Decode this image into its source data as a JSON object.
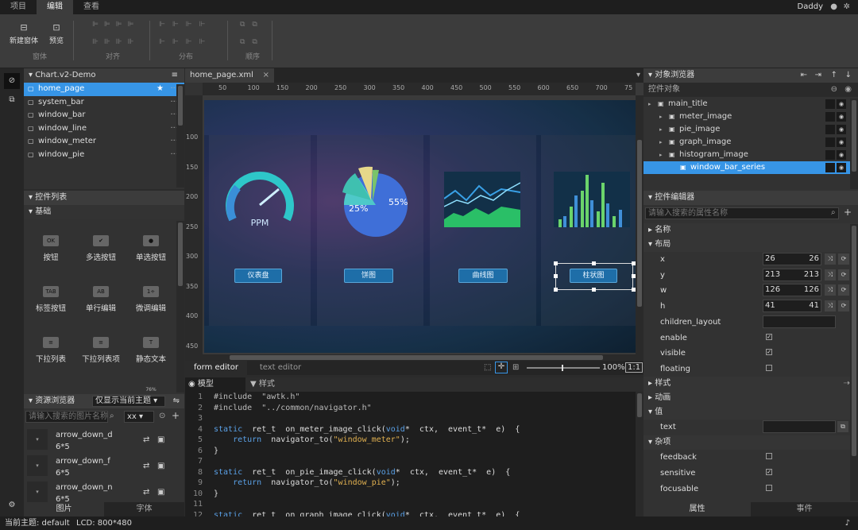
{
  "menu": {
    "tabs": [
      "项目",
      "编辑",
      "查看"
    ],
    "active": 1,
    "user": "Daddy"
  },
  "ribbon": {
    "window_group": {
      "label": "窗体",
      "new_window": "新建窗体",
      "preview": "预览"
    },
    "align_label": "对齐",
    "distribute_label": "分布",
    "order_label": "顺序"
  },
  "project": {
    "title": "Chart.v2-Demo",
    "items": [
      "home_page",
      "system_bar",
      "window_bar",
      "window_line",
      "window_meter",
      "window_pie"
    ],
    "selected": 0
  },
  "widgets": {
    "title": "控件列表",
    "category": "基础",
    "items": [
      {
        "label": "按钮",
        "glyph": "OK"
      },
      {
        "label": "多选按钮",
        "glyph": "✔"
      },
      {
        "label": "单选按钮",
        "glyph": "●"
      },
      {
        "label": "标签按钮",
        "glyph": "TAB"
      },
      {
        "label": "单行编辑",
        "glyph": "AB"
      },
      {
        "label": "微调编辑",
        "glyph": "1÷"
      },
      {
        "label": "下拉列表",
        "glyph": "≡"
      },
      {
        "label": "下拉列表项",
        "glyph": "≡"
      },
      {
        "label": "静态文本",
        "glyph": "T"
      }
    ],
    "partial_glyph": "76%"
  },
  "resources": {
    "title": "资源浏览器",
    "filter": "仅显示当前主题",
    "search_placeholder": "请输入搜索的图片名称",
    "ext": "xx",
    "items": [
      {
        "name": "arrow_down_d",
        "size": "6*5"
      },
      {
        "name": "arrow_down_f",
        "size": "6*5"
      },
      {
        "name": "arrow_down_n",
        "size": "6*5"
      }
    ],
    "tabs": [
      "图片",
      "字体"
    ]
  },
  "editor": {
    "tab": "home_page.xml",
    "ruler_h": [
      "50",
      "100",
      "150",
      "200",
      "250",
      "300",
      "350",
      "400",
      "450",
      "500",
      "550",
      "600",
      "650",
      "700",
      "75"
    ],
    "ruler_v": [
      "100",
      "150",
      "200",
      "250",
      "300",
      "350",
      "400",
      "450"
    ],
    "buttons": [
      "仪表盘",
      "饼图",
      "曲线图",
      "柱状图"
    ],
    "pie": {
      "left": "25%",
      "right": "55%"
    },
    "gauge": "PPM",
    "bottom_tabs": [
      "form editor",
      "text editor"
    ],
    "zoom": "100%",
    "ratio": "1:1"
  },
  "code": {
    "tabs": [
      "模型",
      "样式"
    ],
    "lines": [
      {
        "n": "1",
        "t": [
          [
            "#include  \"awtk.h\"",
            "pp"
          ]
        ]
      },
      {
        "n": "2",
        "t": [
          [
            "#include  \"../common/navigator.h\"",
            "pp"
          ]
        ]
      },
      {
        "n": "3",
        "t": []
      },
      {
        "n": "4",
        "t": [
          [
            "static",
            "kw"
          ],
          [
            "  ret_t  on_meter_image_click(",
            "fn"
          ],
          [
            "void",
            "kw"
          ],
          [
            "*  ctx,  event_t*  e)  {",
            "fn"
          ]
        ]
      },
      {
        "n": "5",
        "t": [
          [
            "    return",
            "kw"
          ],
          [
            "  navigator_to(",
            "fn"
          ],
          [
            "\"window_meter\"",
            "str"
          ],
          [
            ");",
            "fn"
          ]
        ]
      },
      {
        "n": "6",
        "t": [
          [
            "}",
            "fn"
          ]
        ]
      },
      {
        "n": "7",
        "t": []
      },
      {
        "n": "8",
        "t": [
          [
            "static",
            "kw"
          ],
          [
            "  ret_t  on_pie_image_click(",
            "fn"
          ],
          [
            "void",
            "kw"
          ],
          [
            "*  ctx,  event_t*  e)  {",
            "fn"
          ]
        ]
      },
      {
        "n": "9",
        "t": [
          [
            "    return",
            "kw"
          ],
          [
            "  navigator_to(",
            "fn"
          ],
          [
            "\"window_pie\"",
            "str"
          ],
          [
            ");",
            "fn"
          ]
        ]
      },
      {
        "n": "10",
        "t": [
          [
            "}",
            "fn"
          ]
        ]
      },
      {
        "n": "11",
        "t": []
      },
      {
        "n": "12",
        "t": [
          [
            "static",
            "kw"
          ],
          [
            "  ret_t  on_graph_image_click(",
            "fn"
          ],
          [
            "void",
            "kw"
          ],
          [
            "*  ctx,  event_t*  e)  {",
            "fn"
          ]
        ]
      }
    ]
  },
  "objects": {
    "title": "对象浏览器",
    "subtitle": "控件对象",
    "items": [
      {
        "label": "main_title",
        "depth": 0
      },
      {
        "label": "meter_image",
        "depth": 1
      },
      {
        "label": "pie_image",
        "depth": 1
      },
      {
        "label": "graph_image",
        "depth": 1
      },
      {
        "label": "histogram_image",
        "depth": 1
      },
      {
        "label": "window_bar_series",
        "depth": 2
      }
    ],
    "selected": 5
  },
  "props": {
    "title": "控件编辑器",
    "search_placeholder": "请输入搜索的属性名称",
    "sections": {
      "name": "名称",
      "layout": "布局",
      "style": "样式",
      "anim": "动画",
      "value": "值",
      "misc": "杂项"
    },
    "xywh": [
      {
        "k": "x",
        "v": "26",
        "v2": "26"
      },
      {
        "k": "y",
        "v": "213",
        "v2": "213"
      },
      {
        "k": "w",
        "v": "126",
        "v2": "126"
      },
      {
        "k": "h",
        "v": "41",
        "v2": "41"
      }
    ],
    "children_layout": "children_layout",
    "enable": "enable",
    "visible": "visible",
    "floating": "floating",
    "text": "text",
    "feedback": "feedback",
    "sensitive": "sensitive",
    "focusable": "focusable",
    "tabs": [
      "属性",
      "事件"
    ]
  },
  "status": {
    "theme": "当前主题:  default",
    "lcd": "LCD:  800*480"
  }
}
